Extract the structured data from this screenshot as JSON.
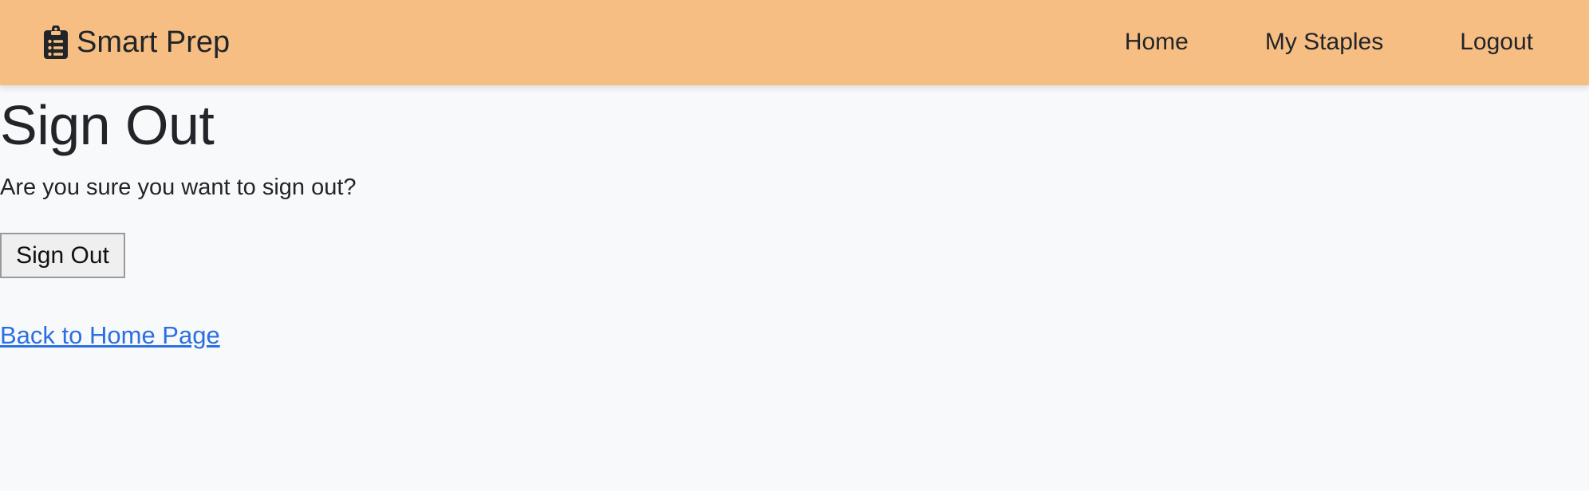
{
  "navbar": {
    "brand": {
      "icon": "clipboard-list-icon",
      "label": "Smart Prep"
    },
    "links": [
      {
        "label": "Home"
      },
      {
        "label": "My Staples"
      },
      {
        "label": "Logout"
      }
    ],
    "background_color": "#f7be83"
  },
  "main": {
    "title": "Sign Out",
    "prompt": "Are you sure you want to sign out?",
    "sign_out_button_label": "Sign Out",
    "back_link_label": "Back to Home Page",
    "link_color": "#2b6fe0"
  }
}
